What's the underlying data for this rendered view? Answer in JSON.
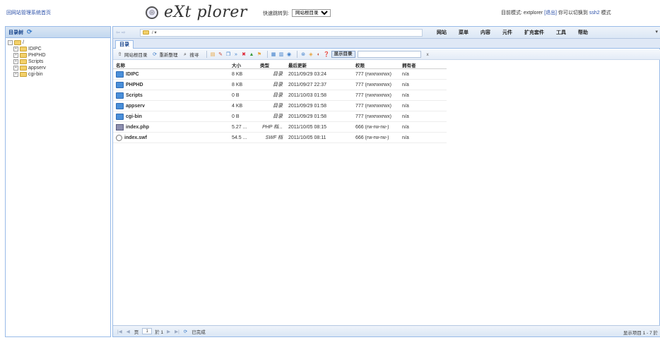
{
  "header": {
    "back_link": "回网站管理系统首页",
    "logo_text": "eXt plorer",
    "logo_badge": "◎",
    "quick_jump_label": "快速跳转到:",
    "quick_jump_value": "网站根目录",
    "mode_prefix": "目前模式: extplorer",
    "mode_logout": "[退出]",
    "mode_switch_text": "你可以切换到",
    "mode_switch_link": "ssh2",
    "mode_suffix": "模式"
  },
  "tree": {
    "title": "目录树",
    "root": "/",
    "items": [
      "IDIPC",
      "PHPHD",
      "Scripts",
      "appserv",
      "cgi-bin"
    ]
  },
  "navbar": {
    "path": "/ ▾",
    "menu": [
      "网站",
      "菜单",
      "内容",
      "元件",
      "扩充套件",
      "工具",
      "帮助"
    ],
    "menu_end": "▾"
  },
  "tab": {
    "label": "目录"
  },
  "toolbar": {
    "parent_dir": "网站根目录",
    "reload": "重新整理",
    "search": "搜寻",
    "show_dirs": "显示目录",
    "clear": "x"
  },
  "grid": {
    "columns": [
      "名称",
      "大小",
      "类型",
      "最后更新",
      "权限",
      "拥有者"
    ],
    "rows": [
      {
        "name": "IDIPC",
        "size": "8 KB",
        "type": "目录",
        "modified": "2011/09/29 03:24",
        "perms": "777 (rwxrwxrwx)",
        "owner": "n/a",
        "icon": "folder-icon"
      },
      {
        "name": "PHPHD",
        "size": "8 KB",
        "type": "目录",
        "modified": "2011/09/27 22:37",
        "perms": "777 (rwxrwxrwx)",
        "owner": "n/a",
        "icon": "folder-icon"
      },
      {
        "name": "Scripts",
        "size": "0 B",
        "type": "目录",
        "modified": "2011/10/03 01:58",
        "perms": "777 (rwxrwxrwx)",
        "owner": "n/a",
        "icon": "folder-icon"
      },
      {
        "name": "appserv",
        "size": "4 KB",
        "type": "目录",
        "modified": "2011/09/29 01:58",
        "perms": "777 (rwxrwxrwx)",
        "owner": "n/a",
        "icon": "folder-icon"
      },
      {
        "name": "cgi-bin",
        "size": "0 B",
        "type": "目录",
        "modified": "2011/09/29 01:58",
        "perms": "777 (rwxrwxrwx)",
        "owner": "n/a",
        "icon": "folder-icon"
      },
      {
        "name": "index.php",
        "size": "5.27 ...",
        "type": "PHP 档...",
        "modified": "2011/10/05 08:15",
        "perms": "666 (rw-rw-rw-)",
        "owner": "n/a",
        "icon": "php-file-icon"
      },
      {
        "name": "index.swf",
        "size": "54.5 ...",
        "type": "SWF 档",
        "modified": "2011/10/05 08:11",
        "perms": "666 (rw-rw-rw-)",
        "owner": "n/a",
        "icon": "swf-file-icon"
      }
    ]
  },
  "statusbar": {
    "page_label": "页",
    "page_value": "1",
    "page_of": "於 1",
    "status": "已完成",
    "item_count": "显示项目 1 - 7 於"
  },
  "colors": {
    "accent": "#15428b",
    "panel_border": "#99bbe8",
    "link": "#2a4fa8"
  }
}
